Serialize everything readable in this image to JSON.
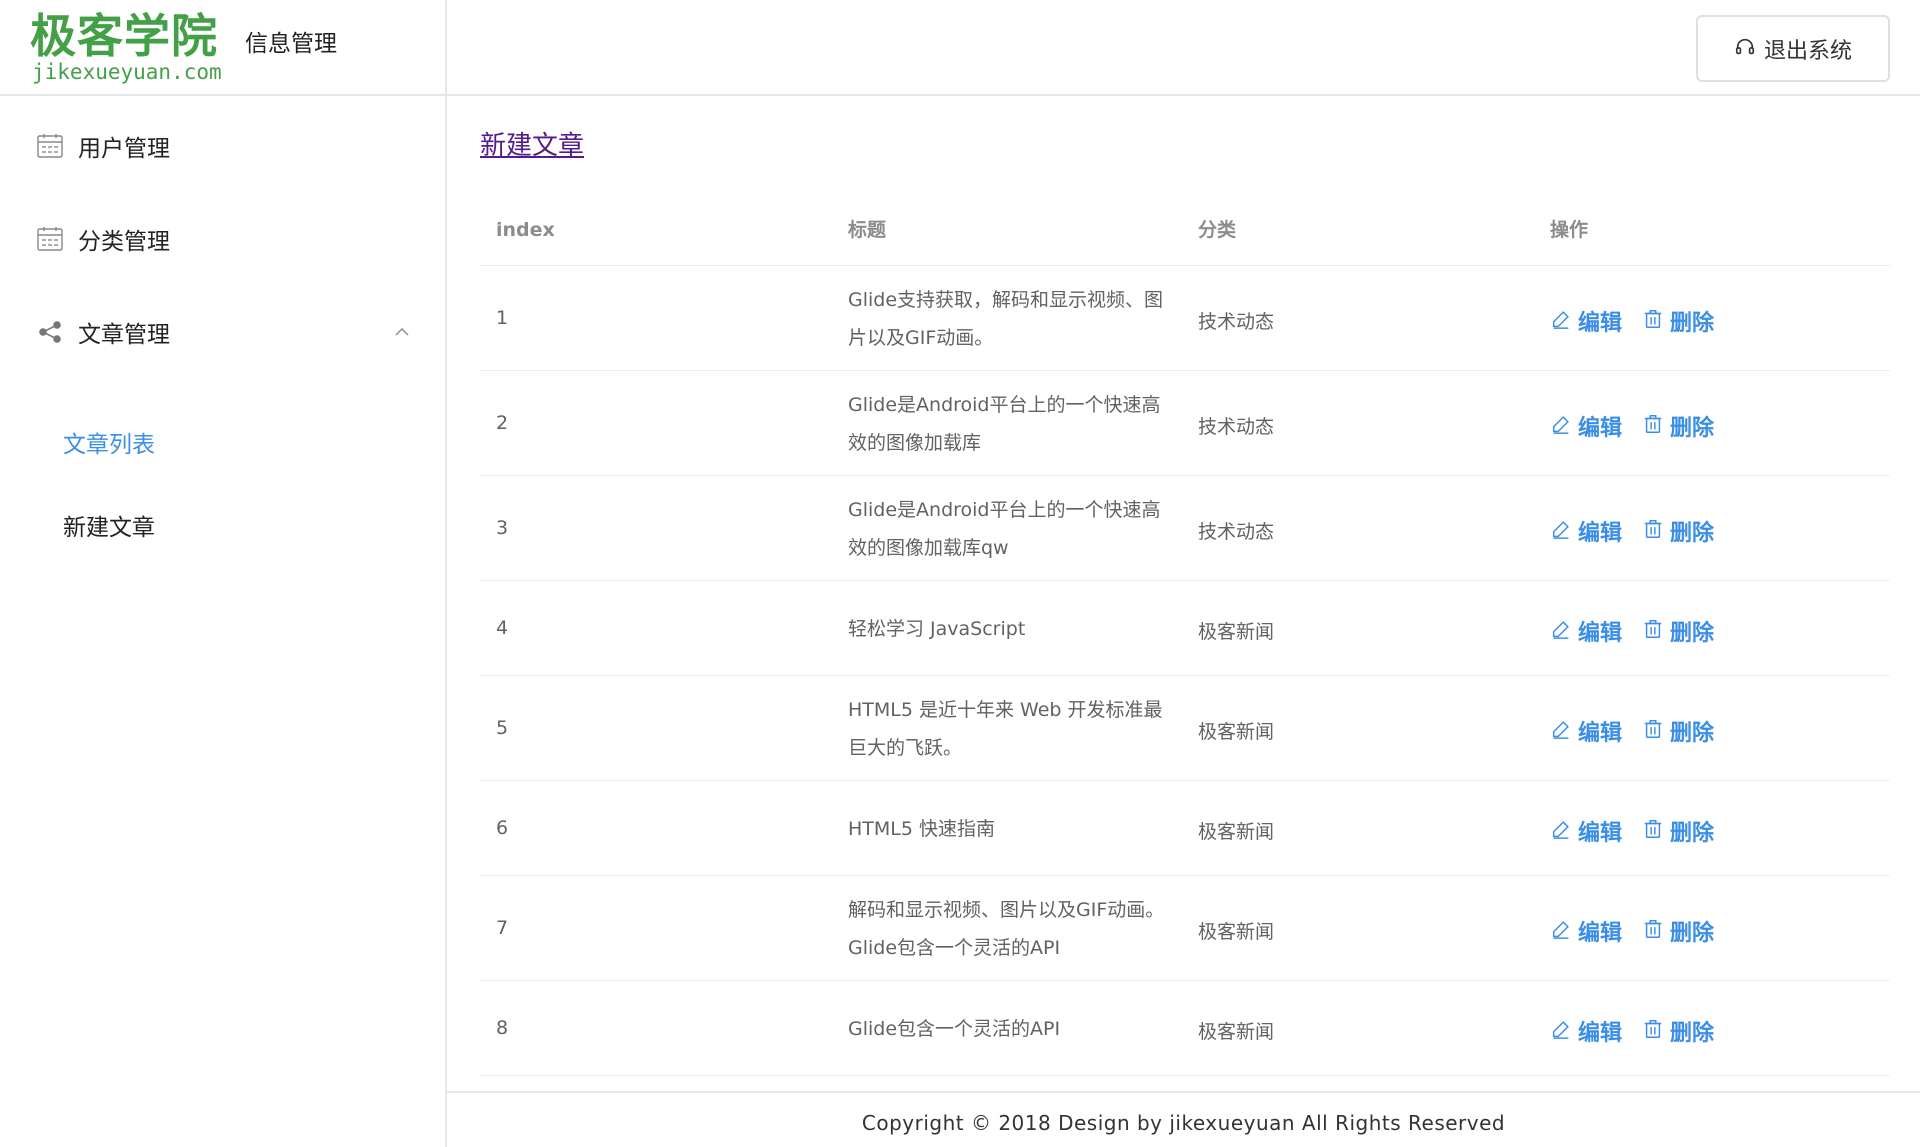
{
  "header": {
    "logo_main": "极客学院",
    "logo_sub": "jikexueyuan.com",
    "app_title": "信息管理",
    "logout_label": "退出系统"
  },
  "sidebar": {
    "items": [
      {
        "label": "用户管理",
        "icon": "calendar-icon"
      },
      {
        "label": "分类管理",
        "icon": "calendar-icon"
      },
      {
        "label": "文章管理",
        "icon": "share-icon",
        "expanded": true
      }
    ],
    "sub_items": [
      {
        "label": "文章列表",
        "active": true
      },
      {
        "label": "新建文章",
        "active": false
      }
    ]
  },
  "main": {
    "new_article_link": "新建文章",
    "columns": [
      "index",
      "标题",
      "分类",
      "操作"
    ],
    "rows": [
      {
        "index": "1",
        "title": "Glide支持获取，解码和显示视频、图片以及GIF动画。",
        "category": "技术动态"
      },
      {
        "index": "2",
        "title": "Glide是Android平台上的一个快速高效的图像加载库",
        "category": "技术动态"
      },
      {
        "index": "3",
        "title": "Glide是Android平台上的一个快速高效的图像加载库qw",
        "category": "技术动态"
      },
      {
        "index": "4",
        "title": "轻松学习 JavaScript",
        "category": "极客新闻"
      },
      {
        "index": "5",
        "title": "HTML5 是近十年来 Web 开发标准最巨大的飞跃。",
        "category": "极客新闻"
      },
      {
        "index": "6",
        "title": "HTML5 快速指南",
        "category": "极客新闻"
      },
      {
        "index": "7",
        "title": "解码和显示视频、图片以及GIF动画。Glide包含一个灵活的API",
        "category": "极客新闻"
      },
      {
        "index": "8",
        "title": "Glide包含一个灵活的API",
        "category": "极客新闻"
      }
    ],
    "edit_label": "编辑",
    "delete_label": "删除",
    "accent_color": "#3a8ee6"
  },
  "footer": {
    "text": "Copyright © 2018 Design by jikexueyuan All Rights Reserved"
  }
}
